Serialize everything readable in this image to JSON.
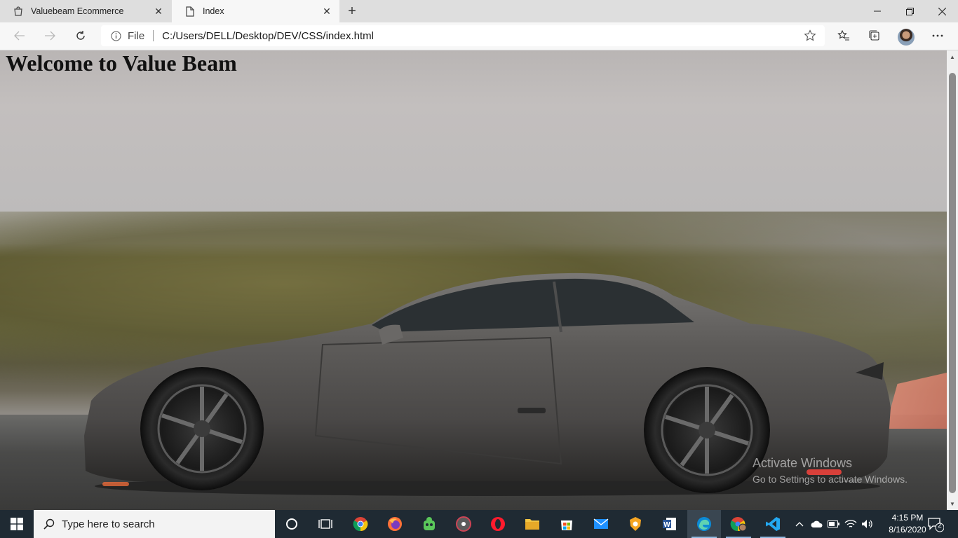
{
  "browser": {
    "tabs": [
      {
        "title": "Valuebeam Ecommerce",
        "icon": "shopping-bag-icon",
        "active": false
      },
      {
        "title": "Index",
        "icon": "page-icon",
        "active": true
      }
    ],
    "address": {
      "scheme_label": "File",
      "url": "C:/Users/DELL/Desktop/DEV/CSS/index.html"
    }
  },
  "page": {
    "heading": "Welcome to Value Beam"
  },
  "watermark": {
    "title": "Activate Windows",
    "subtitle": "Go to Settings to activate Windows."
  },
  "taskbar": {
    "search_placeholder": "Type here to search",
    "apps": [
      "cortana-icon",
      "task-view-icon",
      "chrome-icon",
      "firefox-icon",
      "vpn-icon",
      "media-player-icon",
      "opera-icon",
      "file-explorer-icon",
      "store-icon",
      "mail-icon",
      "brave-icon",
      "word-icon",
      "edge-icon",
      "chrome-profile-icon",
      "vscode-icon"
    ],
    "time": "4:15 PM",
    "date": "8/16/2020",
    "notification_count": "2"
  },
  "colors": {
    "taskbar_bg": "#1f2a33",
    "tab_active_bg": "#f7f7f7",
    "tabstrip_bg": "#dedede"
  }
}
